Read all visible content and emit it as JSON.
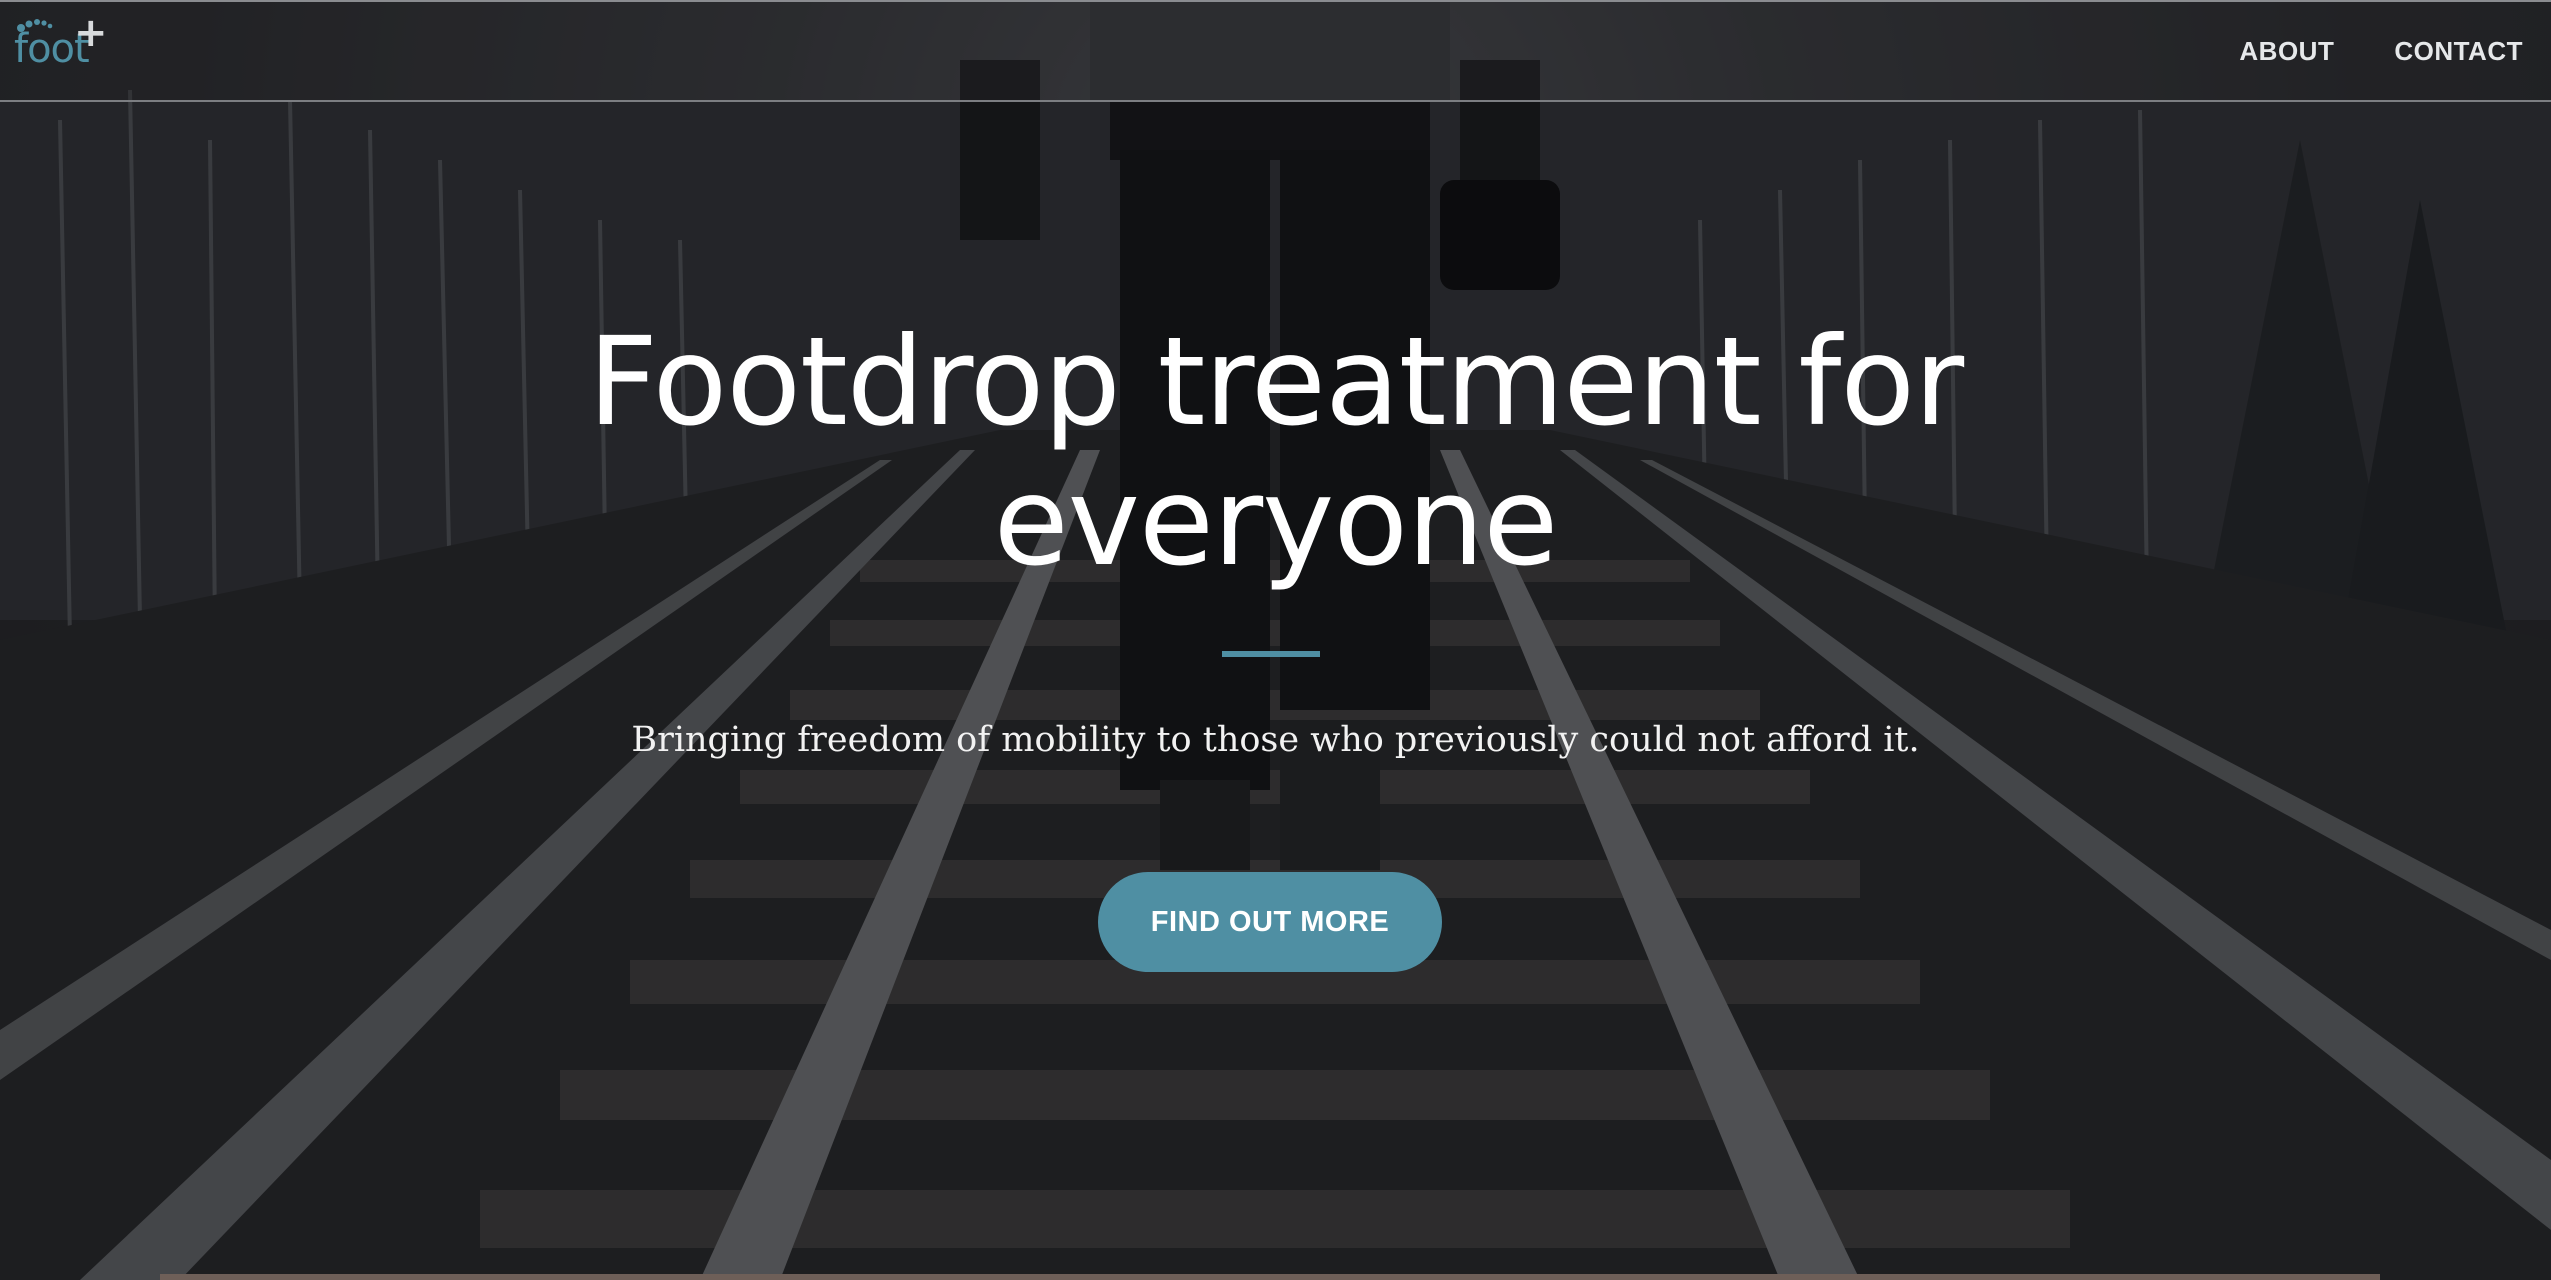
{
  "brand": {
    "logo_text": "foot",
    "logo_plus": "+",
    "accent_color": "#4f8fa3"
  },
  "nav": {
    "items": [
      {
        "label": "ABOUT"
      },
      {
        "label": "CONTACT"
      }
    ]
  },
  "hero": {
    "title_line1": "Footdrop treatment for",
    "title_line2": "everyone",
    "subtitle": "Bringing freedom of mobility to those who previously could not afford it.",
    "cta_label": "FIND OUT MORE",
    "background": "grayscale photo of a person walking on railroad tracks holding a camera"
  }
}
